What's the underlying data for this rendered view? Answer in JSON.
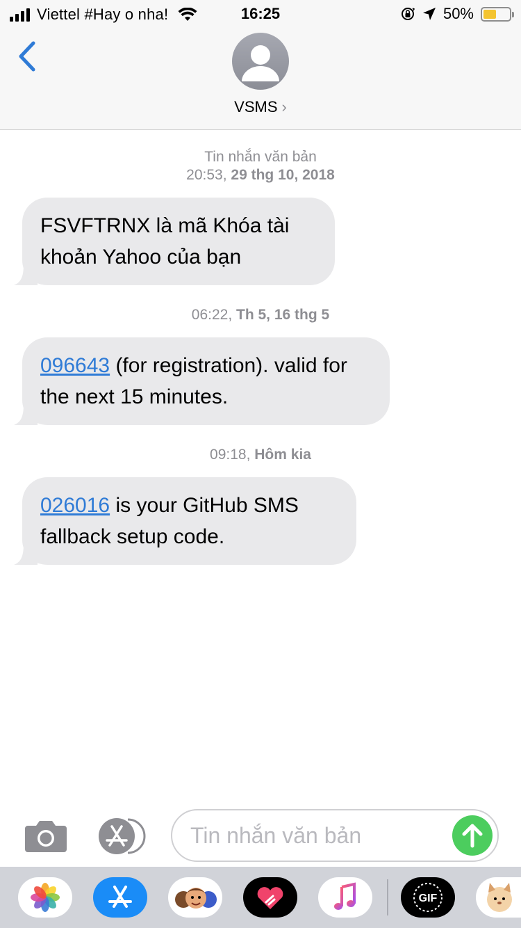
{
  "status_bar": {
    "carrier": "Viettel #Hay o nha!",
    "time": "16:25",
    "battery_percent": "50%",
    "battery_level": 0.5
  },
  "nav": {
    "back_icon": "chevron-left-icon",
    "avatar_icon": "person-icon",
    "contact_name": "VSMS",
    "chevron": "›"
  },
  "messages": [
    {
      "timestamp_prefix": "Tin nhắn văn bản",
      "time": "20:53,",
      "date": "29 thg 10, 2018",
      "link": "",
      "text": "FSVFTRNX là mã Khóa tài khoản Yahoo của bạn"
    },
    {
      "time": "06:22,",
      "date": "Th 5, 16 thg 5",
      "link": "096643",
      "text": " (for registration). valid for the next 15 minutes."
    },
    {
      "time": "09:18,",
      "date": "Hôm kia",
      "link": "026016",
      "text": " is your GitHub SMS fallback setup code."
    }
  ],
  "composer": {
    "camera_icon": "camera-icon",
    "apps_icon": "app-store-icon",
    "placeholder": "Tin nhắn văn bản",
    "send_icon": "arrow-up-icon"
  },
  "app_drawer": [
    {
      "name": "photos-icon",
      "label": "Photos"
    },
    {
      "name": "app-store-icon",
      "label": "App Store"
    },
    {
      "name": "memoji-icon",
      "label": "Memoji"
    },
    {
      "name": "digital-touch-icon",
      "label": "Digital Touch"
    },
    {
      "name": "music-icon",
      "label": "Music"
    },
    {
      "name": "gif-icon",
      "label": "GIF"
    },
    {
      "name": "sticker-icon",
      "label": "Stickers"
    }
  ],
  "colors": {
    "accent": "#2f7bd6",
    "bubble": "#e9e9eb",
    "send": "#4ccd5e",
    "battery": "#f4c430"
  }
}
